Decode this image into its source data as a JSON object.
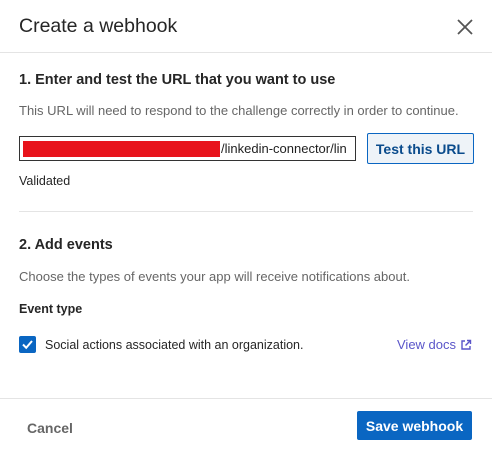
{
  "dialog": {
    "title": "Create a webhook"
  },
  "step1": {
    "heading": "1. Enter and test the URL that you want to use",
    "description": "This URL will need to respond to the challenge correctly in order to continue.",
    "url_visible_suffix": "/linkedin-connector/lin",
    "test_button_label": "Test this URL",
    "status": "Validated"
  },
  "step2": {
    "heading": "2. Add events",
    "description": "Choose the types of events your app will receive notifications about.",
    "event_type_label": "Event type",
    "events": [
      {
        "label": "Social actions associated with an organization.",
        "checked": true
      }
    ],
    "view_docs_label": "View docs"
  },
  "footer": {
    "cancel_label": "Cancel",
    "save_label": "Save webhook"
  },
  "colors": {
    "primary": "#0a66c2",
    "redaction": "#e8141c",
    "link": "#5a55c9"
  }
}
